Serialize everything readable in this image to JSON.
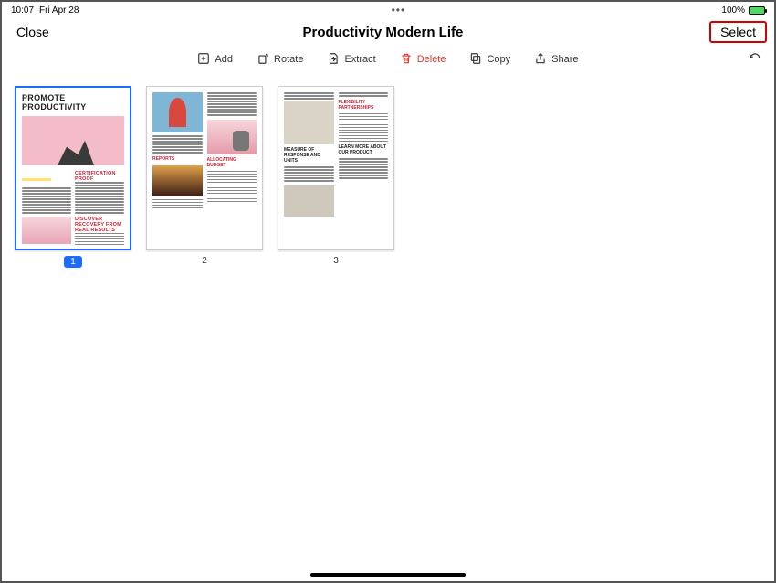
{
  "statusbar": {
    "time": "10:07",
    "date": "Fri Apr 28",
    "battery_pct": "100%"
  },
  "header": {
    "close_label": "Close",
    "title": "Productivity Modern Life",
    "select_label": "Select"
  },
  "toolbar": {
    "add": "Add",
    "rotate": "Rotate",
    "extract": "Extract",
    "delete": "Delete",
    "copy": "Copy",
    "share": "Share"
  },
  "pages": {
    "p1": {
      "num": "1",
      "headline": "PROMOTE PRODUCTIVITY",
      "section_a": "CERTIFICATION PROOF",
      "section_b": "DISCOVER RECOVERY FROM REAL RESULTS"
    },
    "p2": {
      "num": "2",
      "section_a": "REPORTS",
      "section_b": "ALLOCATING BUDGET"
    },
    "p3": {
      "num": "3",
      "section_a": "FLEXIBILITY PARTNERSHIPS",
      "section_b": "MEASURE OF RESPONSE AND UNITS",
      "section_c": "LEARN MORE ABOUT OUR PRODUCT"
    }
  }
}
